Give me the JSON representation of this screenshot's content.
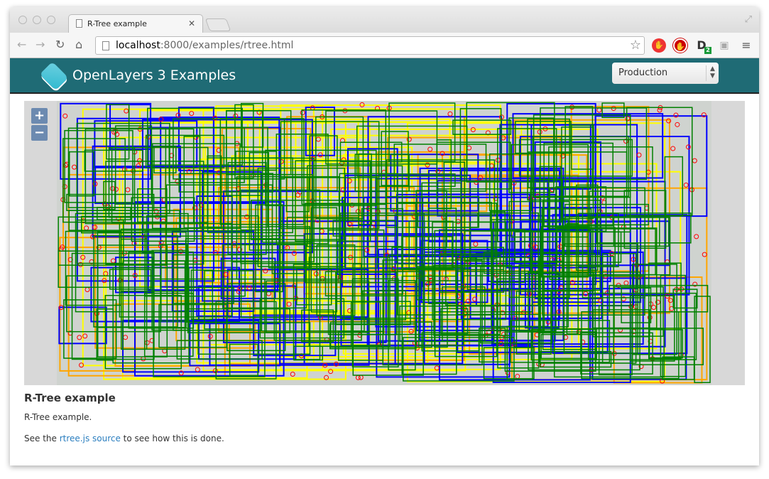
{
  "browser": {
    "tab_title": "R-Tree example",
    "url_host": "localhost",
    "url_path": ":8000/examples/rtree.html"
  },
  "header": {
    "brand": "OpenLayers 3 Examples",
    "mode_select": "Production"
  },
  "map": {
    "zoom_in": "+",
    "zoom_out": "−",
    "colors": {
      "points": "#ff0000",
      "level_1": "#ffff00",
      "level_2": "#ffa500",
      "level_3": "#0000ff",
      "level_4": "#008000"
    }
  },
  "content": {
    "title": "R-Tree example",
    "description": "R-Tree example.",
    "see_prefix": "See the ",
    "link": "rtree.js source",
    "see_suffix": " to see how this is done."
  },
  "extensions": {
    "badge": "2"
  }
}
